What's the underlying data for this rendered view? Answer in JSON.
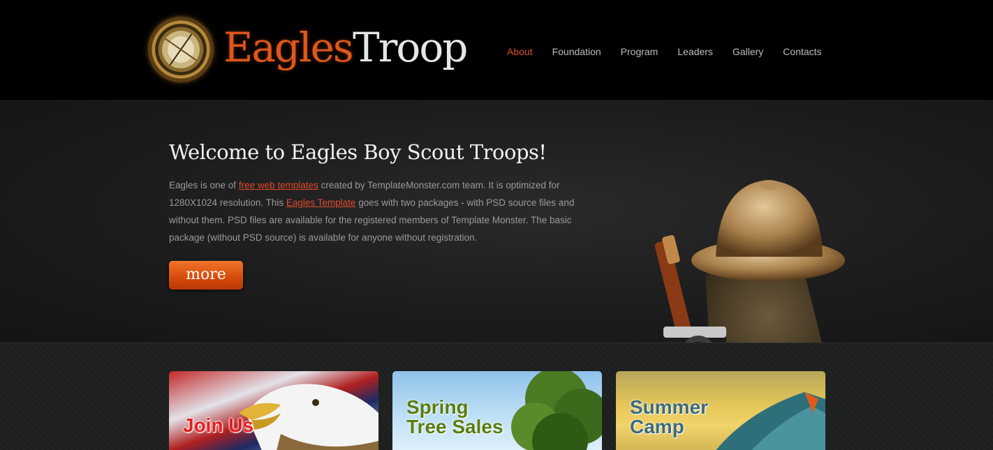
{
  "header": {
    "logo_word_1": "Eagles",
    "logo_word_2": "Troop",
    "nav": [
      {
        "label": "About",
        "active": true
      },
      {
        "label": "Foundation",
        "active": false
      },
      {
        "label": "Program",
        "active": false
      },
      {
        "label": "Leaders",
        "active": false
      },
      {
        "label": "Gallery",
        "active": false
      },
      {
        "label": "Contacts",
        "active": false
      }
    ]
  },
  "hero": {
    "title": "Welcome to Eagles Boy Scout Troops!",
    "text_1": "Eagles is one of ",
    "link_1": "free web templates",
    "text_2": " created by TemplateMonster.com team. It is optimized for 1280X1024 resolution. This ",
    "link_2": "Eagles Template",
    "text_3": " goes with two packages - with PSD source files and without them. PSD files are available for the registered members of Template Monster. The basic package (without PSD source) is available for anyone without registration.",
    "more_label": "more"
  },
  "cards": [
    {
      "line1": "Join Us",
      "line2": ""
    },
    {
      "line1": "Spring",
      "line2": "Tree Sales"
    },
    {
      "line1": "Summer",
      "line2": "Camp"
    }
  ],
  "colors": {
    "accent": "#d9502a",
    "background": "#000000",
    "hero_bg": "#1c1c1c"
  },
  "icons": [
    "compass-logo-icon",
    "scout-gear-image"
  ]
}
